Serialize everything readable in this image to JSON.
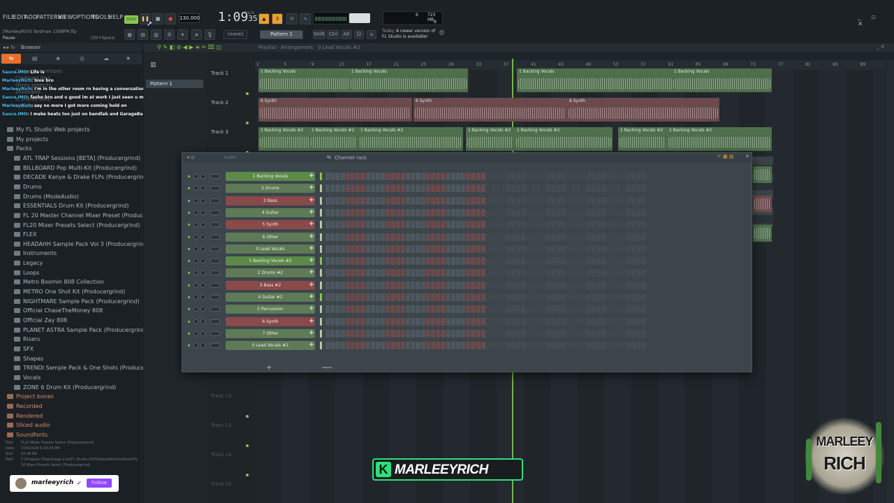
{
  "menu": [
    "FILE",
    "EDIT",
    "ADD",
    "PATTERNS",
    "VIEW",
    "OPTIONS",
    "TOOLS",
    "HELP"
  ],
  "transport": {
    "song_label": "SONG",
    "bpm": "130.000",
    "time": "1:09",
    "time_sub": "35",
    "time_unit": "M:S:CS"
  },
  "hint": {
    "file": "[MarleeyRich] Yardman 130BPM.flp",
    "action": "Pause",
    "shortcut": "Ctrl+Space"
  },
  "pattern": {
    "none": "(none)",
    "name": "Pattern 1"
  },
  "buttons": {
    "shift": "Shift",
    "ctrl": "Ctrl",
    "alt": "Alt"
  },
  "cpu": {
    "value": "6",
    "memory": "723 MB",
    "voices": "8"
  },
  "news": {
    "when": "Today",
    "text": "A newer version of FL Studio is available!"
  },
  "browser": {
    "title": "Browser",
    "chat": [
      {
        "user": "Sauce.IMO",
        "msg": ": Life is"
      },
      {
        "user": "MarleeyRich",
        "msg": ": love bro"
      },
      {
        "user": "MarleeyRich",
        "msg": ": I'm in the other room rn having a conversation I'll be back"
      },
      {
        "user": "Sauce.IMO",
        "msg": ": fasho bro and u good im at work I just seen u msg in the group chat"
      },
      {
        "user": "MarleeyRich",
        "msg": ": say no more I got more coming hold on"
      },
      {
        "user": "Sauce.IMO",
        "msg": ": I make beats too just on bandlab and GarageBand for rn till I get a laptop"
      }
    ],
    "top_items": [
      "Channel envelopes",
      "Clipboard files",
      "Demo projects",
      "Envelopes",
      "IL shared data",
      "Impulses"
    ],
    "items": [
      "My FL Studio Web projects",
      "My projects",
      "Packs",
      "ATL TRAP Sessions [BETA] (Producergrind)",
      "BILLBOARD Pop Multi-Kit (Producergrind)",
      "DECADE Kanye & Drake FLPs (Producergrind)",
      "Drums",
      "Drums (ModeAudio)",
      "ESSENTIALS Drum Kit (Producergrind)",
      "FL 20 Master Channel Mixer Preset (Producergrind)",
      "FL20 Mixer Presets Select (Producergrind)",
      "FLEX",
      "HEADAHH Sample Pack Vol 3 (Producergrind)",
      "Instruments",
      "Legacy",
      "Loops",
      "Metro Boomin 808 Collection",
      "METRO One Shot Kit (Producergrind)",
      "NIGHTMARE Sample Pack (Producergrind)",
      "Official ChaseTheMoney 808",
      "Official Zay 808",
      "PLANET ASTRA Sample Pack (Producergrind)",
      "Risers",
      "SFX",
      "Shapes",
      "TRENDI Sample Pack & One Shots (Producergrind)",
      "Vocals",
      "ZONE 6 Drum Kit (Producergrind)",
      "Project bones",
      "Recorded",
      "Rendered",
      "Sliced audio",
      "Soundfonts"
    ],
    "info": {
      "title_label": "Title",
      "title": "FL20 Mixer Presets Select (Producergrind)",
      "date_label": "Date",
      "date": "7/24/2026 6:19:34 PM",
      "size_label": "Size",
      "size": "63.46 KB",
      "path_label": "Path",
      "path": "C:\\Program Files\\Image-Line\\FL Studio 2025\\Data\\Patches\\Packs\\FL20 Mixer Presets Select (Producergrind)"
    }
  },
  "playlist": {
    "title": "Playlist - Arrangement",
    "crumb": "0 Lead Vocals #2",
    "pattern_tab": "Pattern 1",
    "ruler": [
      "1",
      "5",
      "9",
      "13",
      "17",
      "21",
      "25",
      "29",
      "33",
      "37",
      "41",
      "45",
      "49",
      "53",
      "57",
      "61",
      "65",
      "69",
      "73",
      "77",
      "81",
      "85",
      "89"
    ],
    "tracks": [
      "Track 1",
      "Track 2",
      "Track 3",
      "Track 13",
      "Track 13",
      "Track 14",
      "Track 15"
    ],
    "clip_labels": [
      "1 Backing Vocals",
      "6 Synth",
      "1 Backing Vocals #2"
    ]
  },
  "channel_rack": {
    "title": "Channel rack",
    "filter": "Audio",
    "channels": [
      {
        "name": "1 Backing Vocals",
        "color": "#5c8a4a"
      },
      {
        "name": "2 Drums",
        "color": "#5e7a56"
      },
      {
        "name": "3 Bass",
        "color": "#8a4a4a"
      },
      {
        "name": "4 Guitar",
        "color": "#5e7a56"
      },
      {
        "name": "5 Synth",
        "color": "#8a4a4a"
      },
      {
        "name": "6 Other",
        "color": "#5e7a56"
      },
      {
        "name": "0 Lead Vocals",
        "color": "#5e7a56"
      },
      {
        "name": "1 Backing Vocals #2",
        "color": "#5c8a4a"
      },
      {
        "name": "2 Drums #2",
        "color": "#5e7a56"
      },
      {
        "name": "3 Bass #2",
        "color": "#8a4a4a"
      },
      {
        "name": "4 Guitar #2",
        "color": "#5e7a56"
      },
      {
        "name": "5 Percussion",
        "color": "#5e7a56"
      },
      {
        "name": "6 Synth",
        "color": "#8a4a4a"
      },
      {
        "name": "7 Other",
        "color": "#5e7a56"
      },
      {
        "name": "0 Lead Vocals #2",
        "color": "#5e7a56"
      }
    ]
  },
  "overlay": {
    "brand": "MARLEEYRICH",
    "follow_name": "marleeyrich",
    "follow_btn": "Follow",
    "logo_top": "MARLEEY",
    "logo_bottom": "RICH"
  },
  "colors": {
    "accent": "#8bc34a",
    "clip_green": "#4f6f4c",
    "clip_red": "#6a4a4b",
    "twitch": "#9146ff"
  }
}
